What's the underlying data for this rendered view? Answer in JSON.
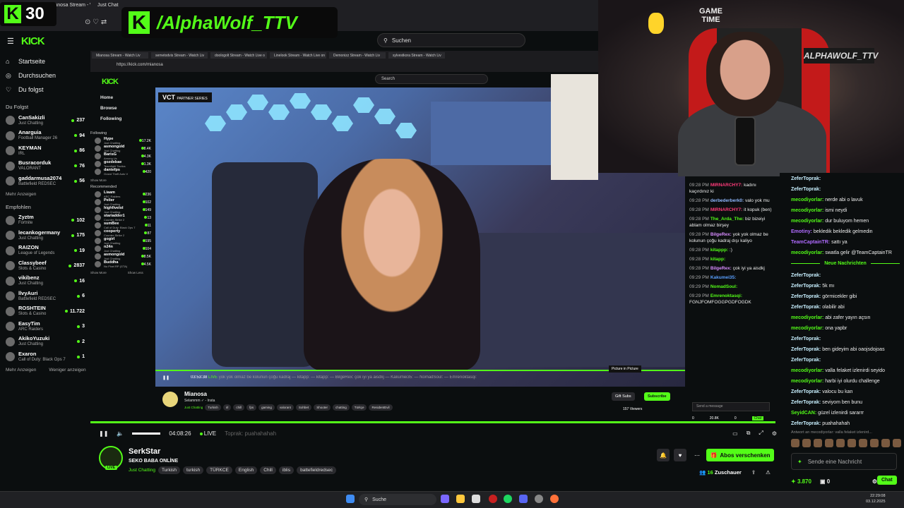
{
  "overlay": {
    "badge_letter": "K",
    "badge_number": "30",
    "name_letter": "K",
    "name_text": "/AlphaWolf_TTV"
  },
  "outer_browser": {
    "tabs": [
      "Mianosa Stream - Watch Liv",
      "Just Chat"
    ],
    "search_placeholder": "Suchen",
    "logo": "KICK"
  },
  "outer_nav": {
    "items": [
      {
        "label": "Startseite",
        "icon": "home-icon"
      },
      {
        "label": "Durchsuchen",
        "icon": "compass-icon"
      },
      {
        "label": "Du folgst",
        "icon": "heart-icon"
      }
    ],
    "following_title": "Du Folgst",
    "following": [
      {
        "name": "CanSakizli",
        "game": "Just Chatting",
        "viewers": "237"
      },
      {
        "name": "Anarguia",
        "game": "Football Manager 26",
        "viewers": "94"
      },
      {
        "name": "KEYMAN",
        "game": "IRL",
        "viewers": "86"
      },
      {
        "name": "Busracorduk",
        "game": "VALORANT",
        "viewers": "76"
      },
      {
        "name": "gaddarmusa2074",
        "game": "Battlefield REDSEC",
        "viewers": "56"
      }
    ],
    "more_following": "Mehr Anzeigen",
    "recommended_title": "Empfohlen",
    "recommended": [
      {
        "name": "Zyztm",
        "game": "Fortnite",
        "viewers": "102"
      },
      {
        "name": "lecankogermany",
        "game": "Just Chatting",
        "viewers": "175"
      },
      {
        "name": "RAIZON",
        "game": "League of Legends",
        "viewers": "19"
      },
      {
        "name": "Classybeef",
        "game": "Slots & Casino",
        "viewers": "2837"
      },
      {
        "name": "vikibenz",
        "game": "Just Chatting",
        "viewers": "16"
      },
      {
        "name": "llvyAuri",
        "game": "Battlefield REDSEC",
        "viewers": "6"
      },
      {
        "name": "ROSHTEIN",
        "game": "Slots & Casino",
        "viewers": "11.722"
      },
      {
        "name": "EasyTim",
        "game": "ARC Raiders",
        "viewers": "3"
      },
      {
        "name": "AkikoYuzuki",
        "game": "Just Chatting",
        "viewers": "2"
      },
      {
        "name": "Exaron",
        "game": "Call of Duty: Black Ops 7",
        "viewers": "1"
      }
    ],
    "more_recommended": "Mehr Anzeigen",
    "less_recommended": "Weniger anzeigen"
  },
  "inner_browser": {
    "tabs": [
      "Mianosa Stream - Watch Liv",
      "semetodvis Stream - Watch Liv",
      "doologolt Stream - Watch Live o",
      "Linelook Stream - Watch Live on",
      "Demonizz Stream - Watch Liv",
      "sylvestkora Stream - Watch Liv"
    ],
    "url": "https://kick.com/mianosa",
    "search_placeholder": "Search",
    "logo": "KICK",
    "nav": [
      "Home",
      "Browse",
      "Following"
    ],
    "following_title": "Following",
    "following": [
      {
        "name": "Hype",
        "game": "Just Chatting",
        "viewers": "17.2K"
      },
      {
        "name": "asmongold",
        "game": "Just Chatting",
        "viewers": "8.4K"
      },
      {
        "name": "BarisG",
        "game": "Among Us",
        "viewers": "4.3K"
      },
      {
        "name": "gozdebae",
        "game": "Teamfight Tactics",
        "viewers": "1.3K"
      },
      {
        "name": "dantefps",
        "game": "Grand Theft Auto V",
        "viewers": "420"
      }
    ],
    "show_more_1": "Show More",
    "recommended_title": "Recommended",
    "recommended": [
      {
        "name": "Liaam",
        "game": "ARC Raiders",
        "viewers": "236"
      },
      {
        "name": "Pelier",
        "game": "Just Chatting",
        "viewers": "102"
      },
      {
        "name": "highfivelol",
        "game": "Just Chatting",
        "viewers": "149"
      },
      {
        "name": "stariadder1",
        "game": "Counter-Strike 2",
        "viewers": "13"
      },
      {
        "name": "sumBee",
        "game": "Call of Duty: Black Ops 7",
        "viewers": "11"
      },
      {
        "name": "cooperty",
        "game": "Counter-Strike 2",
        "viewers": "87"
      },
      {
        "name": "gogirl",
        "game": "Just Chatting",
        "viewers": "195"
      },
      {
        "name": "n24n",
        "game": "Just Chatting",
        "viewers": "104"
      },
      {
        "name": "asmongold",
        "game": "Just Chatting",
        "viewers": "8.5K"
      },
      {
        "name": "Buddha",
        "game": "No Pixel RP (GTA)",
        "viewers": "4.5K"
      }
    ],
    "show_more_2": "Show More",
    "show_less": "Show Less",
    "video": {
      "badge": "VCT",
      "badge_sub": "PARTNER SERIES",
      "time": "03:53:38",
      "live": "LIVE",
      "ticker": "yok yok olmaz be kolunun çoğu kadraj — kitapp: — kitapp: — BilgeRex: çok iyi ya aisdkj — Kakumei35: — NomadSoul: — Emrenoktasqi:",
      "pip": "Picture in Picture"
    },
    "streamer": {
      "name": "Mianosa",
      "status": "Selammm ✓ - Insta",
      "category": "Just Chatting",
      "tags": [
        "Turkish",
        "irl",
        "chill",
        "fps",
        "gaming",
        "valorant",
        "Sohbet",
        "Shooter",
        "chatting",
        "Türkçe",
        "ResidentEvil"
      ],
      "gift": "Gift Subs",
      "subscribe": "Subscribe",
      "viewers": "157 Viewers"
    },
    "chat": [
      {
        "time": "09:28 PM",
        "user": "MIRNARCHY7:",
        "color": "#ff3b7a",
        "text": "kadını kaçırdınız ki"
      },
      {
        "time": "09:28 PM",
        "user": "derbederberk0:",
        "color": "#8fb8ff",
        "text": "valo yok mu"
      },
      {
        "time": "09:28 PM",
        "user": "MIRNARCHY7:",
        "color": "#ff3b7a",
        "text": "it kopuk (ben)"
      },
      {
        "time": "09:28 PM",
        "user": "The_Arda_The:",
        "color": "#53fc18",
        "text": "biz bizeiyi ablam olmaz birşey"
      },
      {
        "time": "09:28 PM",
        "user": "BilgeRex:",
        "color": "#d88cff",
        "text": "yok yok olmaz be kolunun çoğu kadraj dışı kaliyo"
      },
      {
        "time": "09:28 PM",
        "user": "kitappp:",
        "color": "#53fc18",
        "text": ":)"
      },
      {
        "time": "09:28 PM",
        "user": "kitapp:",
        "color": "#53fc18",
        "text": ""
      },
      {
        "time": "09:28 PM",
        "user": "BilgeRex:",
        "color": "#d88cff",
        "text": "çok iyi ya aisdkj"
      },
      {
        "time": "09:29 PM",
        "user": "Kakumei35:",
        "color": "#5aa0ff",
        "text": ""
      },
      {
        "time": "09:29 PM",
        "user": "NomadSoul:",
        "color": "#53fc18",
        "text": ""
      },
      {
        "time": "09:29 PM",
        "user": "Emrenoktasqi:",
        "color": "#53fc18",
        "text": "FGNJFOMFOGGPGDFOGDK"
      }
    ],
    "send_placeholder": "Send a message",
    "footer_values": [
      "0",
      "20.8K",
      "0"
    ],
    "chat_btn": "Chat"
  },
  "webcam": {
    "logo": "ALPHAWOLF_TTV",
    "sign_top": "GAME",
    "sign_bottom": "TIME"
  },
  "outer_chat": {
    "messages_top": [
      {
        "user": "ZeferToprak:",
        "cls": "w",
        "text": ""
      },
      {
        "user": "ZeferToprak:",
        "cls": "w",
        "text": ""
      },
      {
        "user": "mecodiyorlar:",
        "cls": "g",
        "text": "nerde abi o lavuk"
      },
      {
        "user": "mecodiyorlar:",
        "cls": "g",
        "text": "ismi neydi"
      },
      {
        "user": "mecodiyorlar:",
        "cls": "g",
        "text": "dur buluyom hemen"
      },
      {
        "user": "Emotiny:",
        "cls": "p",
        "text": "bekledik bekledik gelmedin"
      },
      {
        "user": "TeamCaptainTR:",
        "cls": "p",
        "text": "sattı ya"
      },
      {
        "user": "mecodiyorlar:",
        "cls": "g",
        "text": "swatla gelir @TeamCaptainTR"
      }
    ],
    "new_messages": "Neue Nachrichten",
    "messages_bottom": [
      {
        "user": "ZeferToprak:",
        "cls": "w",
        "text": ""
      },
      {
        "user": "ZeferToprak:",
        "cls": "w",
        "text": "5k mı"
      },
      {
        "user": "ZeferToprak:",
        "cls": "w",
        "text": "görmicekler gibi"
      },
      {
        "user": "ZeferToprak:",
        "cls": "w",
        "text": "olabilir abi"
      },
      {
        "user": "mecodiyorlar:",
        "cls": "g",
        "text": "abi zafer yayın açsın"
      },
      {
        "user": "mecodiyorlar:",
        "cls": "g",
        "text": "ona yapbr"
      },
      {
        "user": "ZeferToprak:",
        "cls": "w",
        "text": ""
      },
      {
        "user": "ZeferToprak:",
        "cls": "w",
        "text": "ben gideyim abi oaojsdojoas"
      },
      {
        "user": "ZeferToprak:",
        "cls": "w",
        "text": ""
      },
      {
        "user": "mecodiyorlar:",
        "cls": "g",
        "text": "valla felaket izlenirdi seyido"
      },
      {
        "user": "mecodiyorlar:",
        "cls": "g",
        "text": "harbi iyi olurdu challenge"
      },
      {
        "user": "ZeferToprak:",
        "cls": "w",
        "text": "valocu bu kan"
      },
      {
        "user": "ZeferToprak:",
        "cls": "w",
        "text": "seviyom ben bunu"
      },
      {
        "user": "SeyidCAN:",
        "cls": "g",
        "text": "güzel izlenirdi sararrr"
      },
      {
        "user": "ZeferToprak:",
        "cls": "w",
        "text": "puahahahah"
      }
    ],
    "reply_hint": "Antwort an mecodiyorlar: valla felaket izlenird...",
    "send_placeholder": "Sende eine Nachricht",
    "points": "3.870",
    "count": "0",
    "chat_btn": "Chat"
  },
  "outer_player": {
    "time": "04:08:26",
    "live": "LIVE",
    "ticker": "Toprak: puahahahah"
  },
  "outer_streamer": {
    "name": "SerkStar",
    "status": "SEKO BABA ONLİNE",
    "live": "LIVE",
    "category": "Just Chatting",
    "tags": [
      "Turkish",
      "turkish",
      "TÜRKCE",
      "English",
      "Chill",
      "iblis",
      "battefieldredsec"
    ],
    "subscribe": "Abos verschenken",
    "viewers": "16",
    "viewers_label": "Zuschauer"
  },
  "taskbar": {
    "search": "Suche",
    "time": "22:29:08",
    "date": "03.12.2025"
  }
}
